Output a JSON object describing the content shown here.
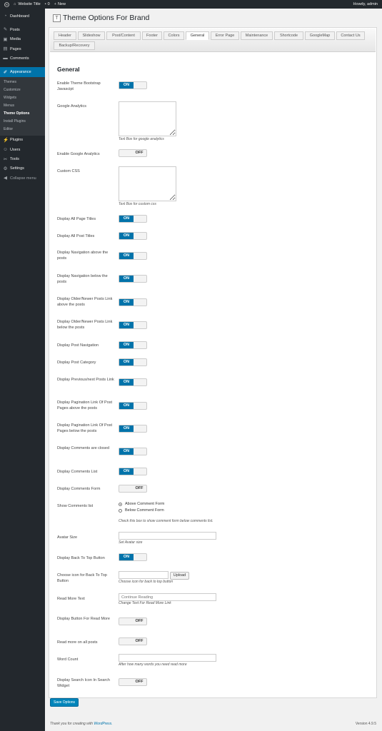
{
  "admin_bar": {
    "site_title": "Website Title",
    "comments_count": "0",
    "new_label": "New",
    "greeting": "Howdy, admin"
  },
  "sidebar": {
    "menu": [
      {
        "label": "Dashboard",
        "icon": "dashboard-icon"
      },
      {
        "label": "Posts",
        "icon": "pin-icon"
      },
      {
        "label": "Media",
        "icon": "media-icon"
      },
      {
        "label": "Pages",
        "icon": "page-icon"
      },
      {
        "label": "Comments",
        "icon": "comment-icon"
      }
    ],
    "appearance": {
      "label": "Appearance",
      "icon": "brush-icon"
    },
    "submenu": [
      "Themes",
      "Customize",
      "Widgets",
      "Menus",
      "Theme Options",
      "Install Plugins",
      "Editor"
    ],
    "menu2": [
      {
        "label": "Plugins",
        "icon": "plugin-icon"
      },
      {
        "label": "Users",
        "icon": "users-icon"
      },
      {
        "label": "Tools",
        "icon": "wrench-icon"
      },
      {
        "label": "Settings",
        "icon": "settings-icon"
      }
    ],
    "collapse": "Collapse menu"
  },
  "page_title": "Theme Options For Brand",
  "tabs": [
    "Header",
    "Slideshow",
    "Post/Content",
    "Footer",
    "Colors",
    "General",
    "Error Page",
    "Maintenance",
    "Shortcode",
    "GoogleMap",
    "Contact Us",
    "Backup/Recovery"
  ],
  "active_tab": "General",
  "section_title": "General",
  "settings": {
    "bootstrap_js": {
      "label": "Enable Theme Bootstrap Javascipt",
      "state": "ON"
    },
    "google_analytics": {
      "label": "Google Analytics",
      "value": "",
      "desc": "Text Box for google analytics"
    },
    "enable_ga": {
      "label": "Enable Google Analytics",
      "state": "OFF"
    },
    "custom_css": {
      "label": "Custom CSS",
      "value": "",
      "desc": "Text Box for custom css"
    },
    "page_titles": {
      "label": "Display All Page Titles",
      "state": "ON"
    },
    "post_titles": {
      "label": "Display All Post Titles",
      "state": "ON"
    },
    "nav_above": {
      "label": "Display Navigation above the posts",
      "state": "ON"
    },
    "nav_below": {
      "label": "Display Navigation below the posts",
      "state": "ON"
    },
    "older_above": {
      "label": "Display Older/Newer Posts Link above the posts",
      "state": "ON"
    },
    "older_below": {
      "label": "Display Older/Newer Posts Link below the posts",
      "state": "ON"
    },
    "post_nav": {
      "label": "Display Post Navigation",
      "state": "ON"
    },
    "post_cat": {
      "label": "Display Post Category",
      "state": "ON"
    },
    "prev_next": {
      "label": "Display Previous/next Posts Link",
      "state": "ON"
    },
    "pag_above": {
      "label": "Display Pagination Link Of Post Pages above the posts",
      "state": "ON"
    },
    "pag_below": {
      "label": "Display Pagination Link Of Post Pages below the posts",
      "state": "ON"
    },
    "comments_closed": {
      "label": "Display Comments are closed",
      "state": "ON"
    },
    "comments_list": {
      "label": "Display Comments List",
      "state": "ON"
    },
    "comments_form": {
      "label": "Display Comments Form",
      "state": "OFF"
    },
    "show_comments": {
      "label": "Show Comments list",
      "options": [
        "Above Comment Form",
        "Below Comment Form"
      ],
      "selected": "Above Comment Form",
      "desc": "Check this box to show comment form below comments list."
    },
    "avatar": {
      "label": "Avatar Size",
      "value": "",
      "desc": "Set Avatar size"
    },
    "back_to_top": {
      "label": "Display Back To Top Button",
      "state": "ON"
    },
    "icon_top": {
      "label": "Choose icon for Back To Top Button",
      "value": "",
      "button": "Upload",
      "desc": "Choose icon for back to top button"
    },
    "read_more_text": {
      "label": "Read More Text",
      "placeholder": "Continue Reading",
      "desc": "Change Text For Read More Link"
    },
    "read_more_btn": {
      "label": "Display Button For Read More",
      "state": "OFF"
    },
    "read_more_all": {
      "label": "Read more on all posts",
      "state": "OFF"
    },
    "word_count": {
      "label": "Word Count",
      "value": "",
      "desc": "After how many words you need read more"
    },
    "search_icon": {
      "label": "Display Search Icon In Search Widget",
      "state": "OFF"
    }
  },
  "save_button": "Save Options",
  "footer": {
    "text": "Thank you for creating with ",
    "link": "WordPress.",
    "version": "Version 4.9.5"
  },
  "colors": {
    "accent": "#0073aa",
    "sidebar": "#23282d",
    "on": "#0073aa"
  }
}
